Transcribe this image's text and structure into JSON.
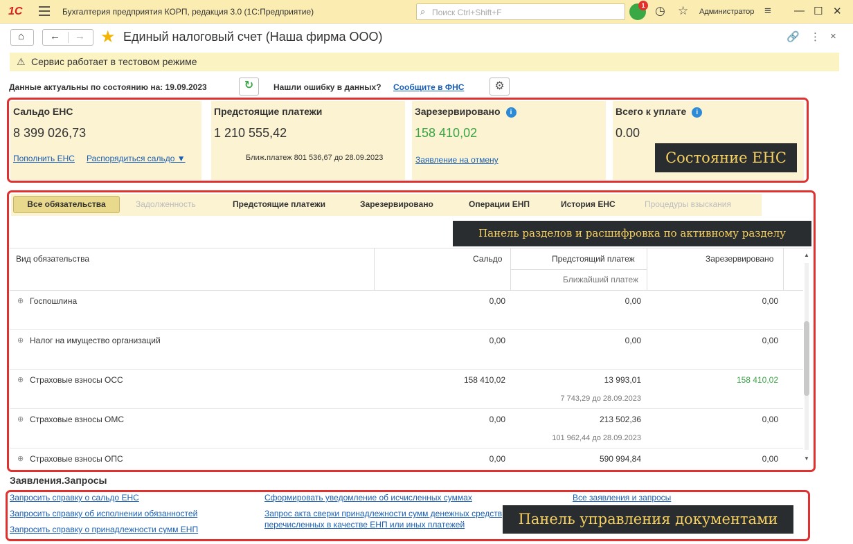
{
  "titlebar": {
    "app_title": "Бухгалтерия предприятия КОРП, редакция 3.0  (1С:Предприятие)",
    "search_placeholder": "Поиск Ctrl+Shift+F",
    "notif_count": "1",
    "user": "Администратор"
  },
  "header": {
    "title": "Единый налоговый счет (Наша фирма ООО)"
  },
  "banner": {
    "text": "Сервис работает в тестовом режиме"
  },
  "actuality": {
    "label": "Данные актуальны по состоянию на:  19.09.2023",
    "error_label": "Нашли ошибку в данных?",
    "error_link": "Сообщите в ФНС"
  },
  "cards": {
    "saldo": {
      "title": "Сальдо ЕНС",
      "value": "8 399 026,73",
      "link1": "Пополнить ЕНС",
      "link2": "Распорядиться сальдо ▼"
    },
    "upcoming": {
      "title": "Предстоящие платежи",
      "value": "1 210 555,42",
      "note": "Ближ.платеж 801 536,67 до 28.09.2023"
    },
    "reserved": {
      "title": "Зарезервировано",
      "value": "158 410,02",
      "link": "Заявление на отмену"
    },
    "total": {
      "title": "Всего к уплате",
      "value": "0.00"
    }
  },
  "overlays": {
    "state": "Состояние ЕНС",
    "panel": "Панель разделов и расшифровка по активному разделу",
    "docs": "Панель управления документами"
  },
  "tabs": [
    {
      "label": "Все обязательства"
    },
    {
      "label": "Задолженность"
    },
    {
      "label": "Предстоящие платежи"
    },
    {
      "label": "Зарезервировано"
    },
    {
      "label": "Операции ЕНП"
    },
    {
      "label": "История ЕНС"
    },
    {
      "label": "Процедуры взыскания"
    }
  ],
  "table": {
    "headers": {
      "kind": "Вид обязательства",
      "saldo": "Сальдо",
      "upcoming": "Предстоящий платеж",
      "nearest": "Ближайший платеж",
      "reserved": "Зарезервировано"
    },
    "rows": [
      {
        "name": "Госпошлина",
        "saldo": "0,00",
        "upcoming": "0,00",
        "nearest": "",
        "reserved": "0,00"
      },
      {
        "name": "Налог на имущество организаций",
        "saldo": "0,00",
        "upcoming": "0,00",
        "nearest": "",
        "reserved": "0,00"
      },
      {
        "name": "Страховые взносы ОСС",
        "saldo": "158 410,02",
        "upcoming": "13 993,01",
        "nearest": "7 743,29 до 28.09.2023",
        "reserved": "158 410,02"
      },
      {
        "name": "Страховые взносы ОМС",
        "saldo": "0,00",
        "upcoming": "213 502,36",
        "nearest": "101 962,44 до 28.09.2023",
        "reserved": "0,00"
      },
      {
        "name": "Страховые взносы ОПС",
        "saldo": "0,00",
        "upcoming": "590 994,84",
        "nearest": "",
        "reserved": "0,00"
      }
    ]
  },
  "docs": {
    "title": "Заявления.Запросы",
    "links": [
      "Запросить справку о сальдо ЕНС",
      "Запросить справку об исполнении обязанностей",
      "Запросить справку о принадлежности сумм ЕНП",
      "Сформировать уведомление об исчисленных суммах",
      "Запрос акта сверки принадлежности сумм денежных средств",
      "перечисленных в качестве ЕНП или иных платежей",
      "Все заявления и запросы"
    ]
  },
  "colors": {
    "accent_red_frame": "#e03131",
    "card_bg": "#fcf3d3",
    "link": "#1a5fb4",
    "positive_green": "#38a444",
    "titlebar_bg": "#fbedb2"
  }
}
